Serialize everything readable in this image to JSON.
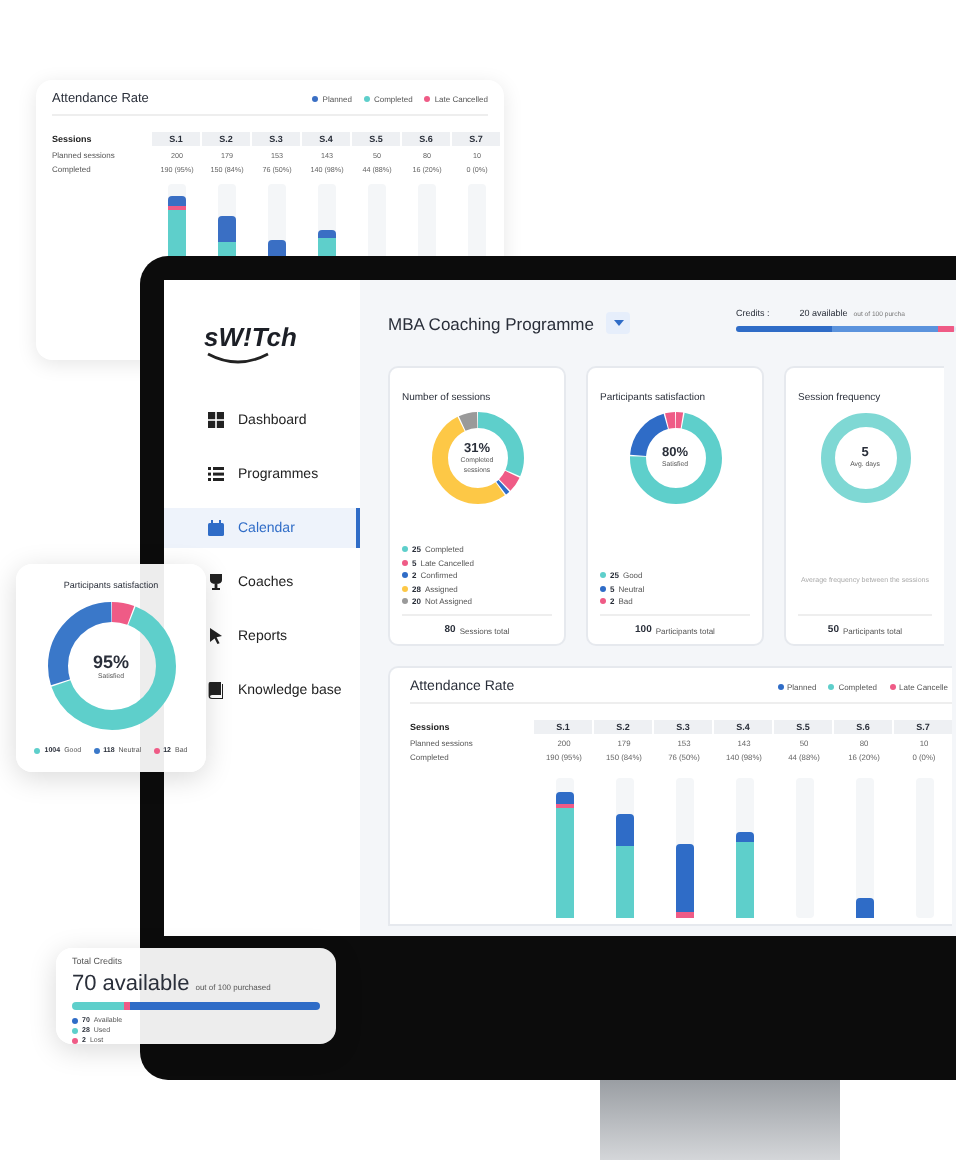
{
  "background_card": {
    "title": "Attendance Rate",
    "legend": [
      {
        "label": "Planned",
        "color": "#3a6fc4"
      },
      {
        "label": "Completed",
        "color": "#5ecfcb"
      },
      {
        "label": "Late Cancelled",
        "color": "#ef5b86"
      }
    ],
    "header_label": "Sessions",
    "sessions": [
      "S.1",
      "S.2",
      "S.3",
      "S.4",
      "S.5",
      "S.6",
      "S.7"
    ],
    "rows": [
      {
        "label": "Planned sessions",
        "values": [
          "200",
          "179",
          "153",
          "143",
          "50",
          "80",
          "10"
        ]
      },
      {
        "label": "Completed",
        "values": [
          "190 (95%)",
          "150 (84%)",
          "76 (50%)",
          "140 (98%)",
          "44 (88%)",
          "16 (20%)",
          "0 (0%)"
        ]
      }
    ]
  },
  "app": {
    "logo": "sW!Tch",
    "nav": [
      {
        "label": "Dashboard",
        "kind": "grid",
        "selected": false
      },
      {
        "label": "Programmes",
        "kind": "list",
        "selected": false
      },
      {
        "label": "Calendar",
        "kind": "calendar",
        "selected": true
      },
      {
        "label": "Coaches",
        "kind": "cup",
        "selected": false
      },
      {
        "label": "Reports",
        "kind": "cursor",
        "selected": false
      },
      {
        "label": "Knowledge base",
        "kind": "book",
        "selected": false
      }
    ],
    "programme_title": "MBA Coaching Programme",
    "credits": {
      "label": "Credits :",
      "available": "20 available",
      "total": "out of 100 purcha"
    },
    "cards": [
      {
        "kind": "donut",
        "title": "Number of sessions",
        "value": "31%",
        "caption": "Completed sessions",
        "legend": [
          {
            "count": "25",
            "label": "Completed",
            "color": "#5ecfcb"
          },
          {
            "count": "5",
            "label": "Late Cancelled",
            "color": "#ef5b86"
          },
          {
            "count": "2",
            "label": "Confirmed",
            "color": "#2f6cc7"
          },
          {
            "count": "28",
            "label": "Assigned",
            "color": "#fdc846"
          },
          {
            "count": "20",
            "label": "Not Assigned",
            "color": "#9a9a9a"
          }
        ],
        "footer_count": "80",
        "footer_label": "Sessions total"
      },
      {
        "kind": "donut",
        "title": "Participants satisfaction",
        "value": "80%",
        "caption": "Satisfied",
        "legend": [
          {
            "count": "25",
            "label": "Good",
            "color": "#5ecfcb"
          },
          {
            "count": "5",
            "label": "Neutral",
            "color": "#2f6cc7"
          },
          {
            "count": "2",
            "label": "Bad",
            "color": "#ef5b86"
          }
        ],
        "footer_count": "100",
        "footer_label": "Participants total"
      },
      {
        "kind": "ring",
        "title": "Session frequency",
        "value": "5",
        "caption": "Avg. days",
        "note": "Average frequency between the sessions",
        "footer_count": "50",
        "footer_label": "Participants total"
      }
    ],
    "attendance": {
      "title": "Attendance Rate",
      "legend": [
        {
          "label": "Planned",
          "color": "#2f6cc7"
        },
        {
          "label": "Completed",
          "color": "#5ecfcb"
        },
        {
          "label": "Late Cancelle",
          "color": "#ef5b86"
        }
      ],
      "header_label": "Sessions",
      "sessions": [
        "S.1",
        "S.2",
        "S.3",
        "S.4",
        "S.5",
        "S.6",
        "S.7"
      ],
      "rows": [
        {
          "label": "Planned sessions",
          "values": [
            "200",
            "179",
            "153",
            "143",
            "50",
            "80",
            "10"
          ]
        },
        {
          "label": "Completed",
          "values": [
            "190 (95%)",
            "150 (84%)",
            "76 (50%)",
            "140 (98%)",
            "44 (88%)",
            "16 (20%)",
            "0 (0%)"
          ]
        }
      ]
    }
  },
  "satisfaction_popup": {
    "title": "Participants satisfaction",
    "value": "95%",
    "caption": "Satisfied",
    "legend": [
      {
        "count": "1004",
        "label": "Good",
        "color": "#5ecfcb"
      },
      {
        "count": "118",
        "label": "Neutral",
        "color": "#3a78c9"
      },
      {
        "count": "12",
        "label": "Bad",
        "color": "#ef5b86"
      }
    ]
  },
  "credits_popup": {
    "title": "Total Credits",
    "available": "70 available",
    "total": "out of 100 purchased",
    "legend": [
      {
        "count": "70",
        "label": "Available",
        "color": "#2f6cc7"
      },
      {
        "count": "28",
        "label": "Used",
        "color": "#5ecfcb"
      },
      {
        "count": "2",
        "label": "Lost",
        "color": "#ef5b86"
      }
    ]
  }
}
